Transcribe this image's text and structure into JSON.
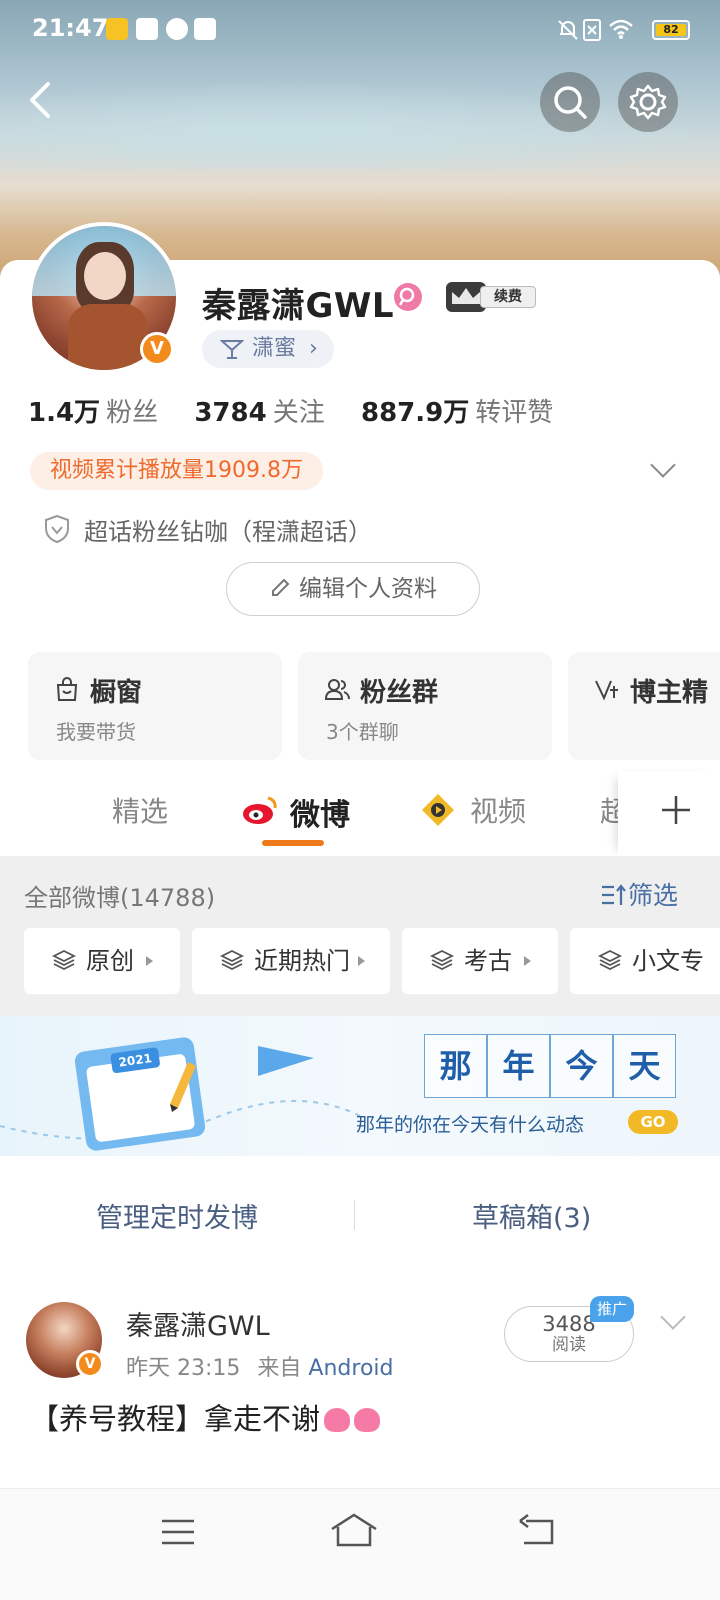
{
  "status_bar": {
    "time": "21:47",
    "battery": "82"
  },
  "profile": {
    "name": "秦露潇GWL",
    "vip_label": "续费",
    "tag": "潇蜜",
    "stats": [
      {
        "value": "1.4万",
        "label": "粉丝"
      },
      {
        "value": "3784",
        "label": "关注"
      },
      {
        "value": "887.9万",
        "label": "转评赞"
      }
    ],
    "video_plays": "视频累计播放量1909.8万",
    "fan_badge": "超话粉丝钻咖（程潇超话）",
    "edit_button": "编辑个人资料"
  },
  "features": [
    {
      "title": "橱窗",
      "subtitle": "我要带货"
    },
    {
      "title": "粉丝群",
      "subtitle": "3个群聊"
    },
    {
      "title": "博主精",
      "subtitle": ""
    }
  ],
  "tabs": [
    {
      "label": "精选"
    },
    {
      "label": "微博"
    },
    {
      "label": "视频"
    },
    {
      "label": "超"
    }
  ],
  "feed_header": {
    "all_label": "全部微博(14788)",
    "filter_label": "筛选"
  },
  "chips": [
    {
      "label": "原创"
    },
    {
      "label": "近期热门"
    },
    {
      "label": "考古"
    },
    {
      "label": "小文专"
    }
  ],
  "promo": {
    "calendar_year": "2021",
    "title_chars": [
      "那",
      "年",
      "今",
      "天"
    ],
    "subtitle": "那年的你在今天有什么动态",
    "go": "GO"
  },
  "manage": {
    "scheduled": "管理定时发博",
    "drafts": "草稿箱(3)"
  },
  "post": {
    "author": "秦露潇GWL",
    "time": "昨天 23:15",
    "source_prefix": "来自",
    "source": "Android",
    "reads": "3488",
    "reads_label": "阅读",
    "promo_tag": "推广",
    "content": "【养号教程】拿走不谢"
  },
  "colors": {
    "accent": "#ee7a1a",
    "link": "#4a6fa5",
    "video_pill_text": "#ee6b2d"
  }
}
